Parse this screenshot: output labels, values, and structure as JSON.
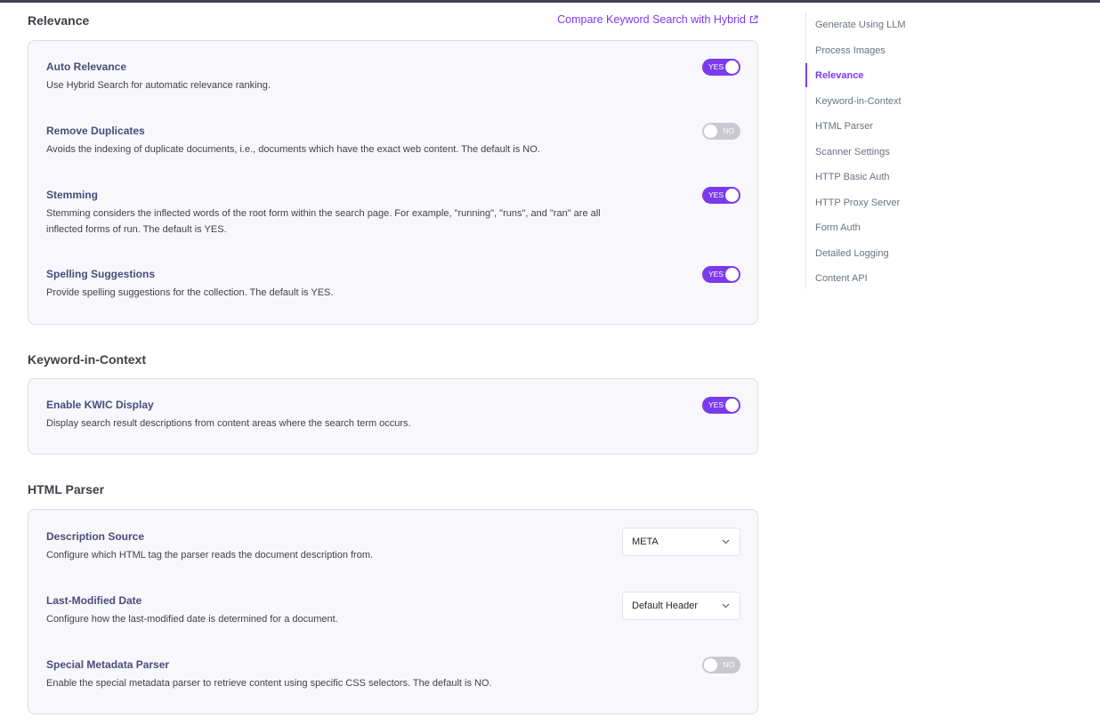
{
  "relevance": {
    "title": "Relevance",
    "compare_link": "Compare Keyword Search with Hybrid",
    "rows": [
      {
        "title": "Auto Relevance",
        "desc": "Use Hybrid Search for automatic relevance ranking.",
        "toggle": "YES"
      },
      {
        "title": "Remove Duplicates",
        "desc": "Avoids the indexing of duplicate documents, i.e., documents which have the exact web content. The default is NO.",
        "toggle": "NO"
      },
      {
        "title": "Stemming",
        "desc1": "Stemming considers the inflected words of the root form within the search page. For example, \"running\", \"runs\", and \"ran\" are all",
        "desc2": "inflected forms of run. The default is YES.",
        "toggle": "YES"
      },
      {
        "title": "Spelling Suggestions",
        "desc": "Provide spelling suggestions for the collection. The default is YES.",
        "toggle": "YES"
      }
    ]
  },
  "kwic": {
    "title": "Keyword-in-Context",
    "rows": [
      {
        "title": "Enable KWIC Display",
        "desc": "Display search result descriptions from content areas where the search term occurs.",
        "toggle": "YES"
      }
    ]
  },
  "html_parser": {
    "title": "HTML Parser",
    "rows": [
      {
        "title": "Description Source",
        "desc": "Configure which HTML tag the parser reads the document description from.",
        "select": "META"
      },
      {
        "title": "Last-Modified Date",
        "desc": "Configure how the last-modified date is determined for a document.",
        "select": "Default Header"
      },
      {
        "title": "Special Metadata Parser",
        "desc": "Enable the special metadata parser to retrieve content using specific CSS selectors. The default is NO.",
        "toggle": "NO"
      }
    ]
  },
  "sidebar": {
    "active_index": 2,
    "items": [
      "Generate Using LLM",
      "Process Images",
      "Relevance",
      "Keyword-in-Context",
      "HTML Parser",
      "Scanner Settings",
      "HTTP Basic Auth",
      "HTTP Proxy Server",
      "Form Auth",
      "Detailed Logging",
      "Content API"
    ]
  },
  "colors": {
    "accent": "#7c3aed",
    "toggle_off": "#c9c9d1",
    "card_bg": "#f8f8fc"
  }
}
